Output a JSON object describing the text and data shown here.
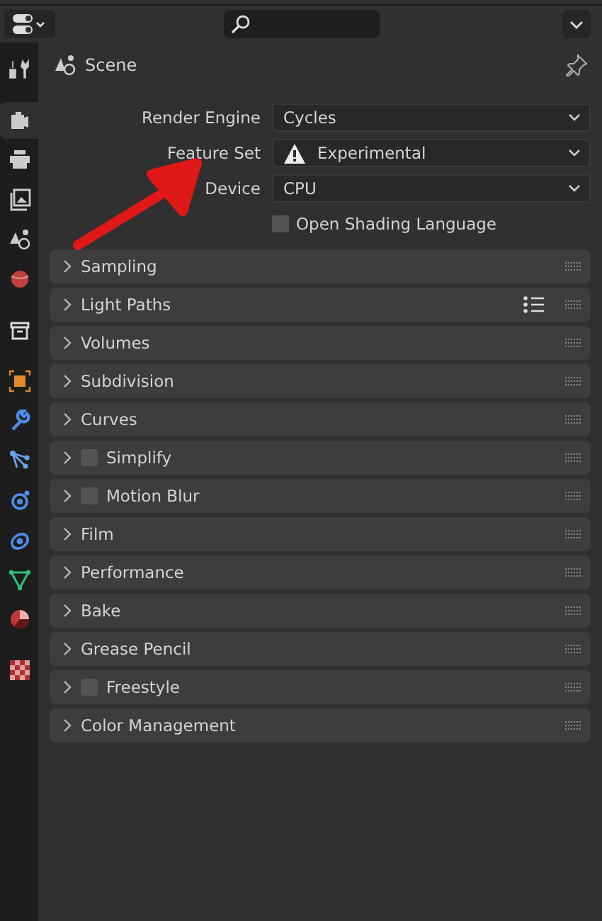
{
  "sidebar": {
    "tabs": [
      {
        "selected": false
      },
      {
        "selected": true
      },
      {
        "selected": false
      },
      {
        "selected": false
      },
      {
        "selected": false
      },
      {
        "selected": false
      },
      {
        "selected": false
      },
      {
        "selected": false
      },
      {
        "selected": false
      },
      {
        "selected": false
      },
      {
        "selected": false
      },
      {
        "selected": false
      },
      {
        "selected": false
      },
      {
        "selected": false
      },
      {
        "selected": false
      }
    ]
  },
  "context": {
    "title": "Scene"
  },
  "properties": [
    {
      "kind": "dropdown",
      "label": "Render Engine",
      "value": "Cycles",
      "warning": false
    },
    {
      "kind": "dropdown",
      "label": "Feature Set",
      "value": "Experimental",
      "warning": true
    },
    {
      "kind": "dropdown",
      "label": "Device",
      "value": "CPU",
      "warning": false
    },
    {
      "kind": "checkbox",
      "label": "Open Shading Language",
      "checked": false
    }
  ],
  "annotation": {
    "kind": "arrow"
  },
  "panels": [
    {
      "kind": "plain",
      "title": "Sampling",
      "expanded": false
    },
    {
      "kind": "presets",
      "title": "Light Paths",
      "expanded": false
    },
    {
      "kind": "plain",
      "title": "Volumes",
      "expanded": false
    },
    {
      "kind": "plain",
      "title": "Subdivision",
      "expanded": false
    },
    {
      "kind": "plain",
      "title": "Curves",
      "expanded": false
    },
    {
      "kind": "toggle",
      "title": "Simplify",
      "expanded": false,
      "checked": false
    },
    {
      "kind": "toggle",
      "title": "Motion Blur",
      "expanded": false,
      "checked": false
    },
    {
      "kind": "plain",
      "title": "Film",
      "expanded": false
    },
    {
      "kind": "plain",
      "title": "Performance",
      "expanded": false
    },
    {
      "kind": "plain",
      "title": "Bake",
      "expanded": false
    },
    {
      "kind": "plain",
      "title": "Grease Pencil",
      "expanded": false
    },
    {
      "kind": "toggle",
      "title": "Freestyle",
      "expanded": false,
      "checked": false
    },
    {
      "kind": "plain",
      "title": "Color Management",
      "expanded": false
    }
  ]
}
